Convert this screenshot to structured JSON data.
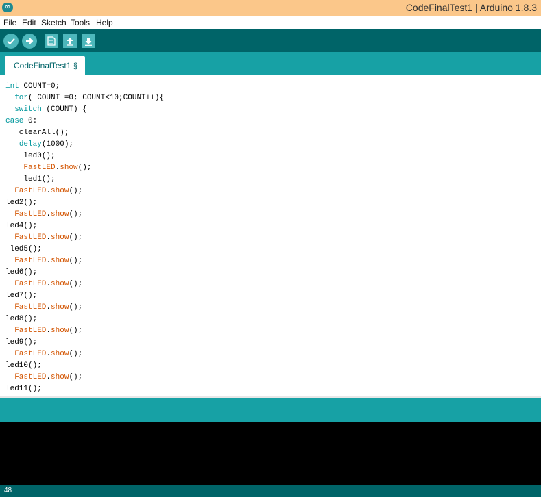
{
  "window": {
    "title": "CodeFinalTest1 | Arduino 1.8.3",
    "logo_glyph": "∞"
  },
  "menu": {
    "items": [
      "File",
      "Edit",
      "Sketch",
      "Tools",
      "Help"
    ]
  },
  "toolbar": {
    "buttons": [
      {
        "icon": "check-icon",
        "action": "Verify"
      },
      {
        "icon": "arrow-right-icon",
        "action": "Upload"
      },
      {
        "icon": "new-file-icon",
        "action": "New"
      },
      {
        "icon": "open-icon",
        "action": "Open"
      },
      {
        "icon": "save-icon",
        "action": "Save"
      }
    ]
  },
  "tabs": [
    {
      "label": "CodeFinalTest1 §"
    }
  ],
  "code": {
    "lines": [
      [
        {
          "t": "int",
          "c": "kw"
        },
        {
          "t": " COUNT=0;"
        }
      ],
      [
        {
          "t": "  "
        },
        {
          "t": "for",
          "c": "kw"
        },
        {
          "t": "( COUNT =0; COUNT<10;COUNT++){"
        }
      ],
      [
        {
          "t": "  "
        },
        {
          "t": "switch",
          "c": "kw"
        },
        {
          "t": " (COUNT) {"
        }
      ],
      [
        {
          "t": "case",
          "c": "kw"
        },
        {
          "t": " 0:"
        }
      ],
      [
        {
          "t": "   clearAll();"
        }
      ],
      [
        {
          "t": "   "
        },
        {
          "t": "delay",
          "c": "kw"
        },
        {
          "t": "(1000);"
        }
      ],
      [
        {
          "t": "    led0();"
        }
      ],
      [
        {
          "t": "    "
        },
        {
          "t": "FastLED",
          "c": "fn"
        },
        {
          "t": "."
        },
        {
          "t": "show",
          "c": "fn"
        },
        {
          "t": "();"
        }
      ],
      [
        {
          "t": "    led1();"
        }
      ],
      [
        {
          "t": "  "
        },
        {
          "t": "FastLED",
          "c": "fn"
        },
        {
          "t": "."
        },
        {
          "t": "show",
          "c": "fn"
        },
        {
          "t": "();"
        }
      ],
      [
        {
          "t": "led2();"
        }
      ],
      [
        {
          "t": "  "
        },
        {
          "t": "FastLED",
          "c": "fn"
        },
        {
          "t": "."
        },
        {
          "t": "show",
          "c": "fn"
        },
        {
          "t": "();"
        }
      ],
      [
        {
          "t": "led4();"
        }
      ],
      [
        {
          "t": "  "
        },
        {
          "t": "FastLED",
          "c": "fn"
        },
        {
          "t": "."
        },
        {
          "t": "show",
          "c": "fn"
        },
        {
          "t": "();"
        }
      ],
      [
        {
          "t": " led5();"
        }
      ],
      [
        {
          "t": "  "
        },
        {
          "t": "FastLED",
          "c": "fn"
        },
        {
          "t": "."
        },
        {
          "t": "show",
          "c": "fn"
        },
        {
          "t": "();"
        }
      ],
      [
        {
          "t": "led6();"
        }
      ],
      [
        {
          "t": "  "
        },
        {
          "t": "FastLED",
          "c": "fn"
        },
        {
          "t": "."
        },
        {
          "t": "show",
          "c": "fn"
        },
        {
          "t": "();"
        }
      ],
      [
        {
          "t": "led7();"
        }
      ],
      [
        {
          "t": "  "
        },
        {
          "t": "FastLED",
          "c": "fn"
        },
        {
          "t": "."
        },
        {
          "t": "show",
          "c": "fn"
        },
        {
          "t": "();"
        }
      ],
      [
        {
          "t": "led8();"
        }
      ],
      [
        {
          "t": "  "
        },
        {
          "t": "FastLED",
          "c": "fn"
        },
        {
          "t": "."
        },
        {
          "t": "show",
          "c": "fn"
        },
        {
          "t": "();"
        }
      ],
      [
        {
          "t": "led9();"
        }
      ],
      [
        {
          "t": "  "
        },
        {
          "t": "FastLED",
          "c": "fn"
        },
        {
          "t": "."
        },
        {
          "t": "show",
          "c": "fn"
        },
        {
          "t": "();"
        }
      ],
      [
        {
          "t": "led10();"
        }
      ],
      [
        {
          "t": "  "
        },
        {
          "t": "FastLED",
          "c": "fn"
        },
        {
          "t": "."
        },
        {
          "t": "show",
          "c": "fn"
        },
        {
          "t": "();"
        }
      ],
      [
        {
          "t": "led11();"
        }
      ]
    ]
  },
  "status": {
    "message": "",
    "line_number": "48"
  },
  "colors": {
    "title_bar": "#fbc78a",
    "toolbar": "#006468",
    "tab_strip": "#17a1a5",
    "keyword": "#00979c",
    "function": "#d35400",
    "console": "#000000"
  }
}
